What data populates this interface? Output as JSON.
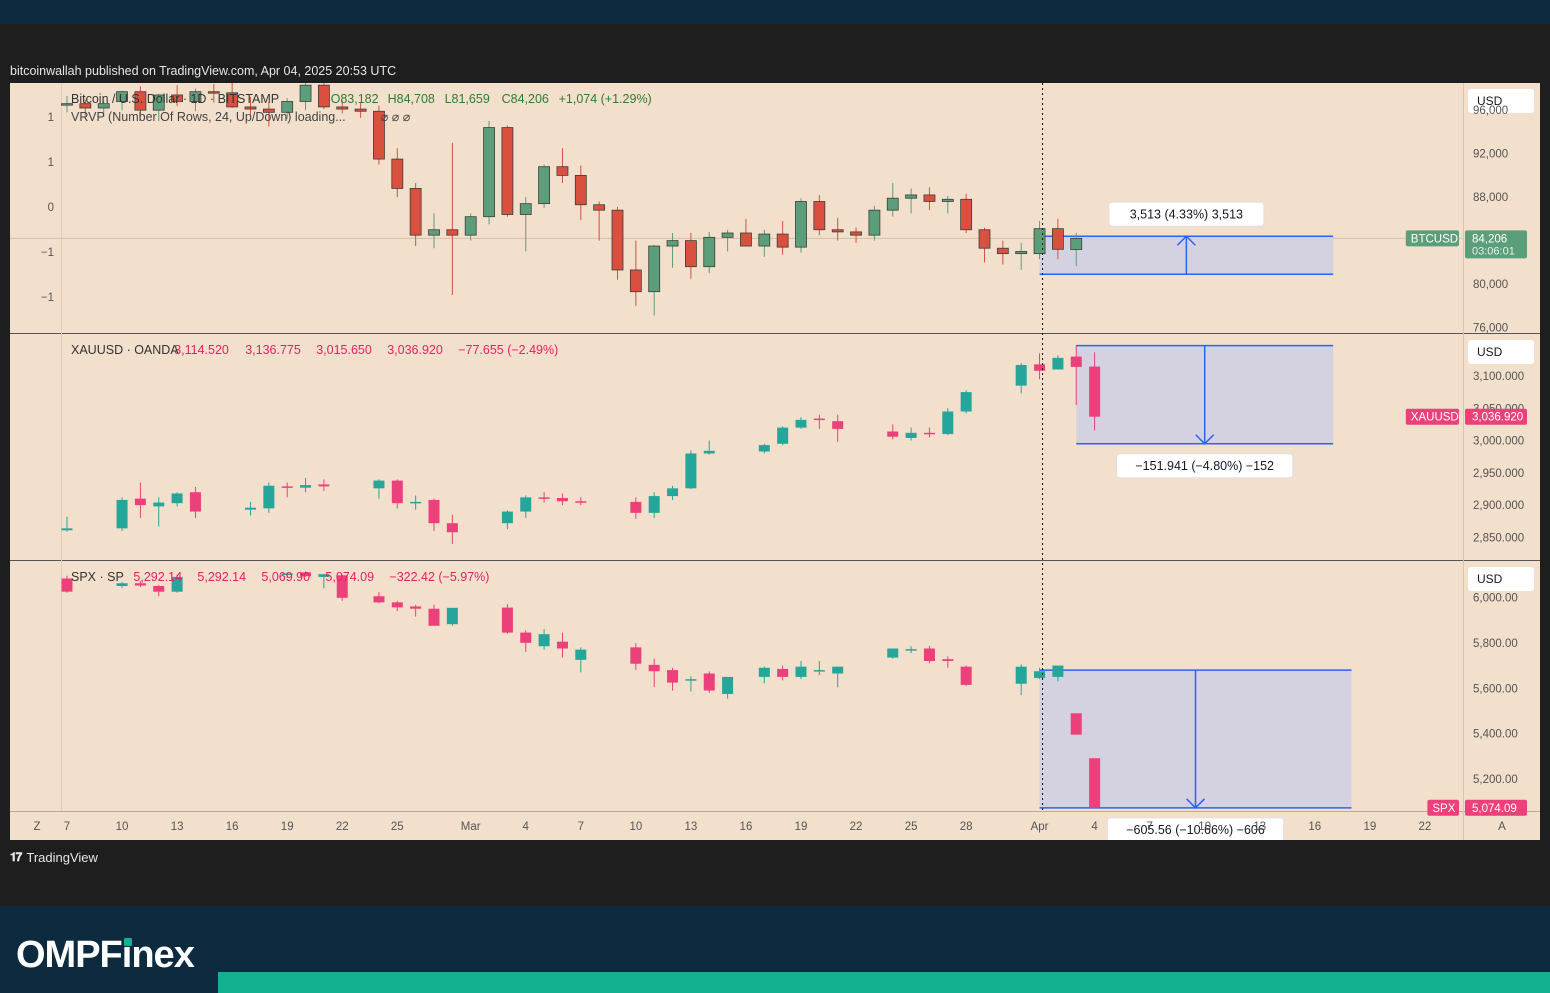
{
  "publisher": "bitcoinwallah published on TradingView.com, Apr 04, 2025 20:53 UTC",
  "footer_logo": "TradingView",
  "brand": {
    "part1": "OMPF",
    "part2": "i",
    "part3": "nex"
  },
  "colors": {
    "up_btc": "#5c9e79",
    "down_btc": "#d9503f",
    "up": "#26a69a",
    "down": "#ec407a",
    "bg": "#f2dfcc",
    "box": "#2962ff",
    "box_fill": "#cfcfe3"
  },
  "time_axis": {
    "labels": [
      {
        "i": 0,
        "t": "7"
      },
      {
        "i": 3,
        "t": "10"
      },
      {
        "i": 6,
        "t": "13"
      },
      {
        "i": 9,
        "t": "16"
      },
      {
        "i": 12,
        "t": "19"
      },
      {
        "i": 15,
        "t": "22"
      },
      {
        "i": 18,
        "t": "25"
      },
      {
        "i": 22,
        "t": "Mar"
      },
      {
        "i": 25,
        "t": "4"
      },
      {
        "i": 28,
        "t": "7"
      },
      {
        "i": 31,
        "t": "10"
      },
      {
        "i": 34,
        "t": "13"
      },
      {
        "i": 37,
        "t": "16"
      },
      {
        "i": 40,
        "t": "19"
      },
      {
        "i": 43,
        "t": "22"
      },
      {
        "i": 46,
        "t": "25"
      },
      {
        "i": 49,
        "t": "28"
      },
      {
        "i": 53,
        "t": "Apr"
      },
      {
        "i": 56,
        "t": "4"
      },
      {
        "i": 59,
        "t": "7"
      },
      {
        "i": 62,
        "t": "10"
      },
      {
        "i": 65,
        "t": "13"
      },
      {
        "i": 68,
        "t": "16"
      },
      {
        "i": 71,
        "t": "19"
      },
      {
        "i": 74,
        "t": "22"
      }
    ],
    "left_button": "Z",
    "right_button": "A"
  },
  "chart_data": [
    {
      "type": "candlestick",
      "title": "Bitcoin / U.S. Dollar · 1D · BITSTAMP",
      "ohlc_header": {
        "o": "O83,182",
        "h": "H84,708",
        "l": "L81,659",
        "c": "C84,206",
        "chg": "+1,074 (+1.29%)"
      },
      "indicator": "VRVP (Number Of Rows, 24, Up/Down) loading...",
      "indicator_icons": "⌀ ⌀ ⌀",
      "left_scale": [
        "1",
        "1",
        "0",
        "−1",
        "−1"
      ],
      "currency": "USD",
      "ticks": [
        "96,000",
        "92,000",
        "88,000",
        "80,000",
        "76,000"
      ],
      "tick_values": [
        96000,
        92000,
        88000,
        80000,
        76000
      ],
      "ylim": [
        75500,
        98500
      ],
      "last_price": {
        "symbol": "BTCUSD",
        "value": "84,206",
        "countdown": "03:06:01",
        "v": 84206
      },
      "measure": {
        "label": "3,513 (4.33%) 3,513",
        "from": 80900,
        "to": 84400,
        "i0": 53,
        "i1": 69
      },
      "candles": [
        [
          0,
          96500,
          97300,
          95800,
          96600
        ],
        [
          1,
          96600,
          97000,
          95500,
          96200
        ],
        [
          2,
          96200,
          96900,
          95400,
          96600
        ],
        [
          3,
          96800,
          97800,
          96000,
          97700
        ],
        [
          4,
          97700,
          98200,
          95500,
          96000
        ],
        [
          5,
          96000,
          97500,
          95000,
          97400
        ],
        [
          6,
          97400,
          98300,
          96400,
          96800
        ],
        [
          7,
          96800,
          98000,
          95900,
          97700
        ],
        [
          8,
          97700,
          98400,
          96700,
          97600
        ],
        [
          9,
          97600,
          98500,
          96200,
          96300
        ],
        [
          10,
          96300,
          97200,
          95600,
          96100
        ],
        [
          11,
          96100,
          96700,
          94500,
          95800
        ],
        [
          12,
          95800,
          97100,
          95200,
          96800
        ],
        [
          13,
          96800,
          98500,
          96000,
          98300
        ],
        [
          14,
          98300,
          98600,
          96100,
          96300
        ],
        [
          15,
          96300,
          96900,
          95700,
          96100
        ],
        [
          16,
          96100,
          96700,
          95300,
          95900
        ],
        [
          17,
          95900,
          96400,
          91000,
          91500
        ],
        [
          18,
          91500,
          92500,
          88000,
          88800
        ],
        [
          19,
          88800,
          89300,
          83500,
          84500
        ],
        [
          20,
          84500,
          86500,
          83300,
          85000
        ],
        [
          21,
          85000,
          93000,
          79000,
          84500
        ],
        [
          22,
          84500,
          86500,
          84000,
          86200
        ],
        [
          23,
          86200,
          95000,
          85500,
          94400
        ],
        [
          24,
          94400,
          94600,
          86200,
          86400
        ],
        [
          25,
          86400,
          88000,
          83000,
          87400
        ],
        [
          26,
          87400,
          91000,
          87000,
          90800
        ],
        [
          27,
          90800,
          92500,
          89300,
          90000
        ],
        [
          28,
          90000,
          90900,
          85900,
          87300
        ],
        [
          29,
          87300,
          87600,
          84000,
          86800
        ],
        [
          30,
          86800,
          87100,
          80400,
          81300
        ],
        [
          31,
          81300,
          84000,
          78000,
          79300
        ],
        [
          32,
          79300,
          83600,
          77100,
          83500
        ],
        [
          33,
          83500,
          84700,
          81500,
          84000
        ],
        [
          34,
          84000,
          84700,
          80500,
          81600
        ],
        [
          35,
          81600,
          84800,
          81000,
          84300
        ],
        [
          36,
          84300,
          85000,
          83000,
          84700
        ],
        [
          37,
          84700,
          86000,
          83600,
          83500
        ],
        [
          38,
          83500,
          85000,
          82500,
          84600
        ],
        [
          39,
          84600,
          85800,
          82700,
          83400
        ],
        [
          40,
          83400,
          87900,
          82900,
          87600
        ],
        [
          41,
          87600,
          88200,
          84500,
          85000
        ],
        [
          42,
          85000,
          86100,
          84000,
          84800
        ],
        [
          43,
          84800,
          85200,
          83800,
          84500
        ],
        [
          44,
          84500,
          87200,
          84000,
          86800
        ],
        [
          45,
          86800,
          89300,
          86200,
          87900
        ],
        [
          46,
          87900,
          88800,
          86500,
          88200
        ],
        [
          47,
          88200,
          88900,
          86800,
          87600
        ],
        [
          48,
          87600,
          88100,
          86500,
          87800
        ],
        [
          49,
          87800,
          88300,
          84700,
          85000
        ],
        [
          50,
          85000,
          85200,
          82000,
          83300
        ],
        [
          51,
          83300,
          84000,
          81800,
          82800
        ],
        [
          52,
          82800,
          83800,
          81300,
          83000
        ],
        [
          53,
          82800,
          85800,
          82300,
          85100
        ],
        [
          54,
          85100,
          86000,
          82300,
          83200
        ],
        [
          55,
          83182,
          84708,
          81659,
          84206
        ]
      ]
    },
    {
      "type": "candlestick",
      "title": "XAUUSD · OANDA",
      "ohlc_header": {
        "o": "3,114.520",
        "h": "3,136.775",
        "l": "3,015.650",
        "c": "3,036.920",
        "chg": "−77.655 (−2.49%)"
      },
      "currency": "USD",
      "ticks": [
        "3,100.000",
        "3,050.000",
        "3,000.000",
        "2,950.000",
        "2,900.000",
        "2,850.000"
      ],
      "tick_values": [
        3100,
        3050,
        3000,
        2950,
        2900,
        2850
      ],
      "ylim": [
        2815,
        3165
      ],
      "last_price": {
        "symbol": "XAUUSD",
        "value": "3,036.920",
        "v": 3036.92
      },
      "measure": {
        "label": "−151.941 (−4.80%) −152",
        "from": 3147,
        "to": 2995,
        "i0": 55,
        "i1": 69
      },
      "candles": [
        [
          0,
          2861,
          2882,
          2859,
          2864
        ],
        [
          3,
          2864,
          2912,
          2860,
          2908
        ],
        [
          4,
          2910,
          2935,
          2880,
          2900
        ],
        [
          5,
          2898,
          2912,
          2867,
          2904
        ],
        [
          6,
          2903,
          2920,
          2898,
          2918
        ],
        [
          7,
          2920,
          2928,
          2880,
          2890
        ],
        [
          10,
          2893,
          2905,
          2884,
          2896
        ],
        [
          11,
          2895,
          2935,
          2888,
          2930
        ],
        [
          12,
          2929,
          2935,
          2912,
          2928
        ],
        [
          13,
          2927,
          2942,
          2920,
          2931
        ],
        [
          14,
          2932,
          2940,
          2922,
          2929
        ],
        [
          17,
          2926,
          2940,
          2910,
          2938
        ],
        [
          18,
          2938,
          2940,
          2895,
          2903
        ],
        [
          19,
          2905,
          2915,
          2893,
          2905
        ],
        [
          20,
          2908,
          2910,
          2860,
          2872
        ],
        [
          21,
          2872,
          2885,
          2840,
          2858
        ],
        [
          24,
          2872,
          2892,
          2863,
          2890
        ],
        [
          25,
          2890,
          2915,
          2880,
          2912
        ],
        [
          26,
          2912,
          2920,
          2904,
          2910
        ],
        [
          27,
          2911,
          2918,
          2900,
          2906
        ],
        [
          28,
          2906,
          2912,
          2900,
          2905
        ],
        [
          31,
          2905,
          2912,
          2879,
          2888
        ],
        [
          32,
          2888,
          2920,
          2880,
          2914
        ],
        [
          33,
          2914,
          2930,
          2908,
          2926
        ],
        [
          34,
          2926,
          2985,
          2925,
          2980
        ],
        [
          35,
          2980,
          3000,
          2978,
          2984
        ],
        [
          38,
          2983,
          2995,
          2980,
          2993
        ],
        [
          39,
          2995,
          3022,
          2993,
          3020
        ],
        [
          40,
          3020,
          3036,
          3018,
          3032
        ],
        [
          41,
          3034,
          3040,
          3018,
          3032
        ],
        [
          42,
          3030,
          3040,
          2998,
          3018
        ],
        [
          45,
          3014,
          3025,
          3002,
          3006
        ],
        [
          46,
          3004,
          3020,
          3000,
          3012
        ],
        [
          47,
          3012,
          3020,
          3005,
          3010
        ],
        [
          48,
          3010,
          3050,
          3008,
          3045
        ],
        [
          49,
          3045,
          3078,
          3042,
          3075
        ],
        [
          52,
          3085,
          3120,
          3073,
          3117
        ],
        [
          53,
          3118,
          3135,
          3095,
          3108
        ],
        [
          54,
          3110,
          3132,
          3110,
          3128
        ],
        [
          55,
          3130,
          3148,
          3055,
          3114
        ],
        [
          56,
          3114.52,
          3136.775,
          3015.65,
          3036.92
        ]
      ]
    },
    {
      "type": "candlestick",
      "title": "SPX · SP",
      "ohlc_header": {
        "o": "5,292.14",
        "h": "5,292.14",
        "l": "5,069.90",
        "c": "5,074.09",
        "chg": "−322.42 (−5.97%)"
      },
      "currency": "USD",
      "ticks": [
        "6,000.00",
        "5,800.00",
        "5,600.00",
        "5,400.00",
        "5,200.00"
      ],
      "tick_values": [
        6000,
        5800,
        5600,
        5400,
        5200
      ],
      "ylim": [
        5060,
        6160
      ],
      "last_price": {
        "symbol": "SPX",
        "value": "5,074.09",
        "v": 5074.09
      },
      "measure": {
        "label": "−605.56 (−10.66%) −606",
        "from": 5680,
        "to": 5074,
        "i0": 53,
        "i1": 70
      },
      "candles": [
        [
          0,
          6083,
          6095,
          6020,
          6025
        ],
        [
          3,
          6050,
          6068,
          6042,
          6062
        ],
        [
          4,
          6062,
          6072,
          6045,
          6052
        ],
        [
          5,
          6050,
          6055,
          6005,
          6025
        ],
        [
          6,
          6025,
          6100,
          6020,
          6090
        ],
        [
          12,
          6100,
          6110,
          6085,
          6105
        ],
        [
          13,
          6110,
          6115,
          6090,
          6093
        ],
        [
          14,
          6090,
          6095,
          6040,
          6102
        ],
        [
          15,
          6097,
          6100,
          5985,
          5998
        ],
        [
          17,
          6005,
          6023,
          5975,
          5978
        ],
        [
          18,
          5978,
          5985,
          5940,
          5956
        ],
        [
          19,
          5960,
          5967,
          5915,
          5950
        ],
        [
          20,
          5950,
          5968,
          5880,
          5875
        ],
        [
          21,
          5882,
          5930,
          5875,
          5954
        ],
        [
          24,
          5955,
          5970,
          5840,
          5845
        ],
        [
          25,
          5845,
          5855,
          5760,
          5800
        ],
        [
          26,
          5785,
          5860,
          5770,
          5838
        ],
        [
          27,
          5805,
          5845,
          5735,
          5775
        ],
        [
          28,
          5725,
          5780,
          5670,
          5770
        ],
        [
          31,
          5780,
          5798,
          5680,
          5708
        ],
        [
          32,
          5703,
          5730,
          5605,
          5675
        ],
        [
          33,
          5680,
          5690,
          5590,
          5625
        ],
        [
          34,
          5640,
          5653,
          5585,
          5640
        ],
        [
          35,
          5665,
          5675,
          5580,
          5590
        ],
        [
          36,
          5575,
          5650,
          5555,
          5650
        ],
        [
          38,
          5650,
          5695,
          5622,
          5690
        ],
        [
          39,
          5685,
          5700,
          5635,
          5650
        ],
        [
          40,
          5650,
          5720,
          5640,
          5695
        ],
        [
          41,
          5675,
          5720,
          5658,
          5680
        ],
        [
          42,
          5665,
          5690,
          5605,
          5695
        ],
        [
          45,
          5735,
          5765,
          5730,
          5775
        ],
        [
          46,
          5770,
          5785,
          5755,
          5772
        ],
        [
          47,
          5775,
          5787,
          5710,
          5720
        ],
        [
          48,
          5728,
          5740,
          5690,
          5720
        ],
        [
          49,
          5695,
          5700,
          5610,
          5615
        ],
        [
          52,
          5620,
          5705,
          5570,
          5695
        ],
        [
          53,
          5645,
          5690,
          5640,
          5675
        ],
        [
          54,
          5650,
          5700,
          5630,
          5700
        ],
        [
          55,
          5490,
          5490,
          5396,
          5396
        ],
        [
          56,
          5292.14,
          5292.14,
          5069.9,
          5074.09
        ]
      ]
    }
  ]
}
